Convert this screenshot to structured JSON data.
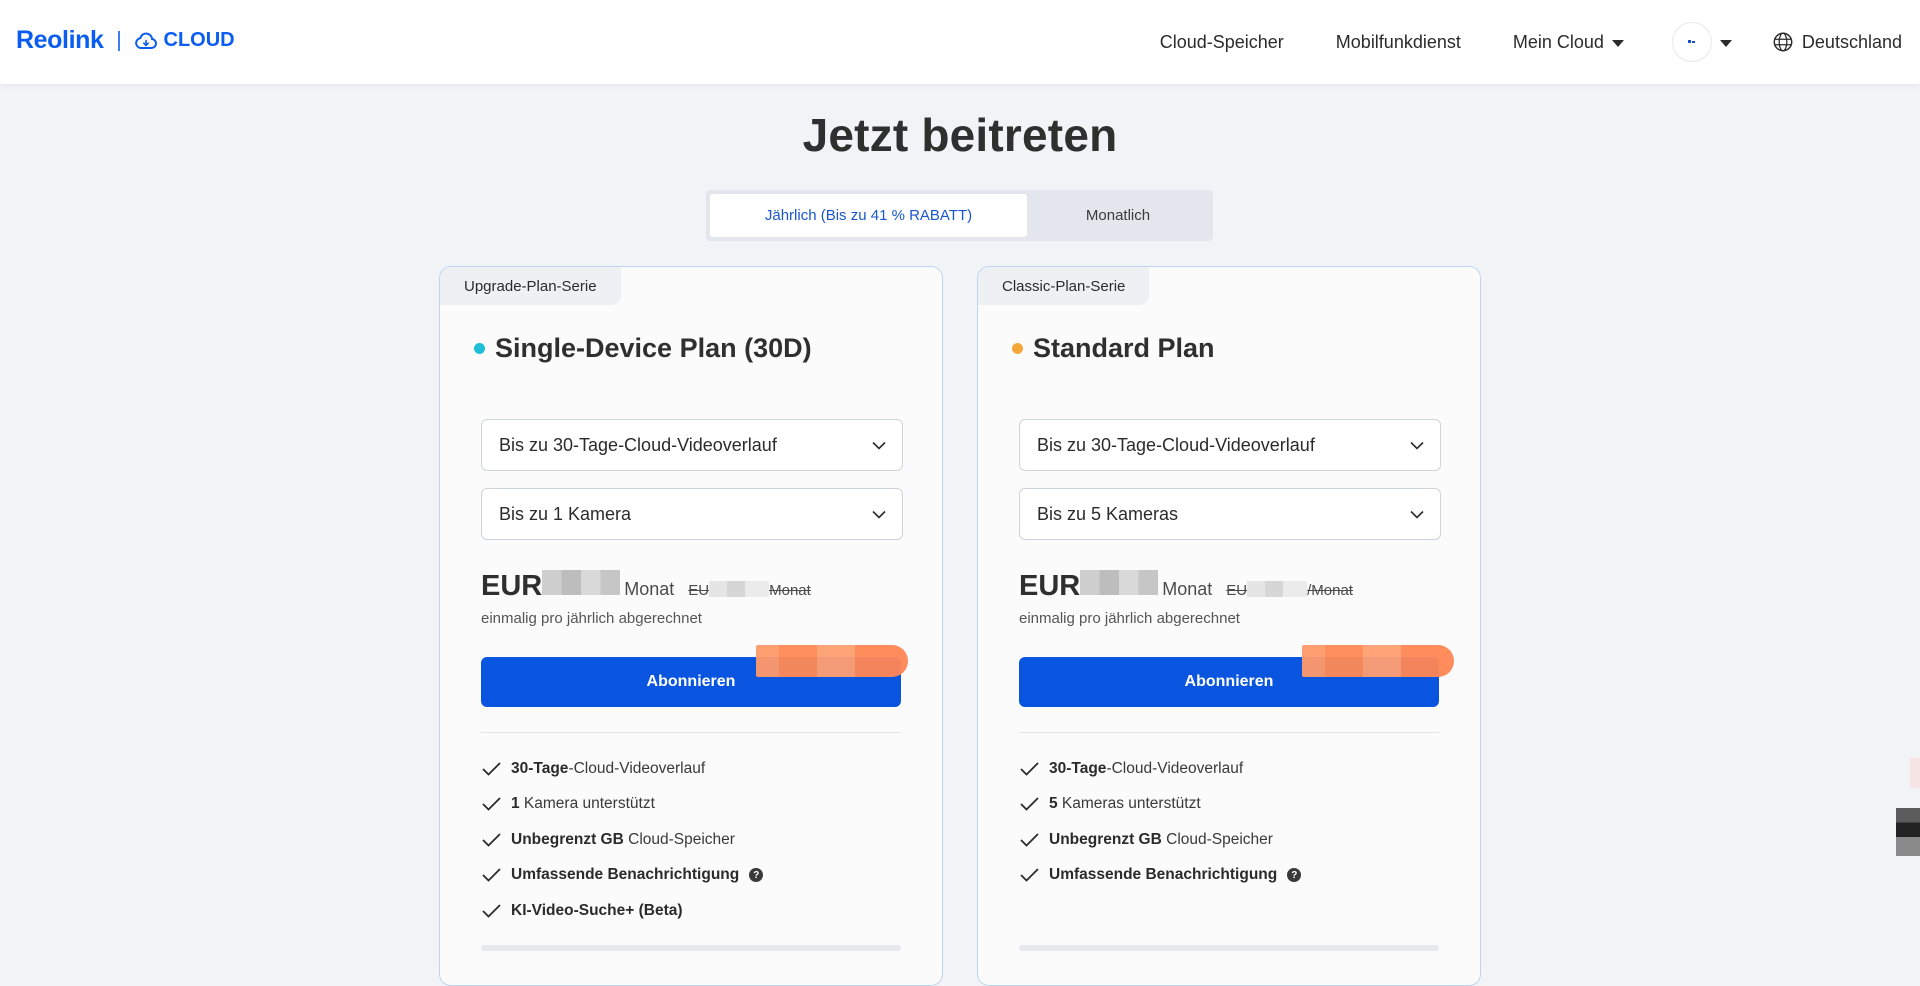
{
  "header": {
    "brand": "Reolink",
    "product": "CLOUD",
    "nav": [
      {
        "label": "Cloud-Speicher"
      },
      {
        "label": "Mobilfunkdienst"
      },
      {
        "label": "Mein Cloud"
      }
    ],
    "region": "Deutschland"
  },
  "page": {
    "title": "Jetzt beitreten"
  },
  "billing_toggle": {
    "yearly": "Jährlich (Bis zu 41 % RABATT)",
    "monthly": "Monatlich",
    "selected": "yearly"
  },
  "plans": [
    {
      "series": "Upgrade-Plan-Serie",
      "name": "Single-Device Plan (30D)",
      "dot_color": "#1fbfd6",
      "history_select": "Bis zu 30-Tage-Cloud-Videoverlauf",
      "camera_select": "Bis zu 1 Kamera",
      "price_prefix": "EUR",
      "per_month": "Monat",
      "old_price_prefix": "EU",
      "old_per_month": "Monat",
      "billing_note": "einmalig pro jährlich abgerechnet",
      "subscribe": "Abonnieren",
      "features": [
        {
          "bold": "30-Tage",
          "text": "-Cloud-Videoverlauf"
        },
        {
          "bold": "1",
          "text": " Kamera unterstützt"
        },
        {
          "bold": "Unbegrenzt GB",
          "text": " Cloud-Speicher"
        },
        {
          "bold": "Umfassende Benachrichtigung",
          "text": ""
        },
        {
          "bold": "KI-Video-Suche+ (Beta)",
          "text": ""
        }
      ]
    },
    {
      "series": "Classic-Plan-Serie",
      "name": "Standard Plan",
      "dot_color": "#f5a63a",
      "history_select": "Bis zu 30-Tage-Cloud-Videoverlauf",
      "camera_select": "Bis zu 5 Kameras",
      "price_prefix": "EUR",
      "per_month": "Monat",
      "old_price_prefix": "EU",
      "old_per_month": "/Monat",
      "billing_note": "einmalig pro jährlich abgerechnet",
      "subscribe": "Abonnieren",
      "features": [
        {
          "bold": "30-Tage",
          "text": "-Cloud-Videoverlauf"
        },
        {
          "bold": "5",
          "text": " Kameras unterstützt"
        },
        {
          "bold": "Unbegrenzt GB",
          "text": " Cloud-Speicher"
        },
        {
          "bold": "Umfassende Benachrichtigung",
          "text": ""
        }
      ]
    }
  ],
  "colors": {
    "accent": "#0a55e0",
    "brand": "#0a5df0",
    "card_border": "#bcd6f1",
    "background": "#f1f3f7"
  }
}
